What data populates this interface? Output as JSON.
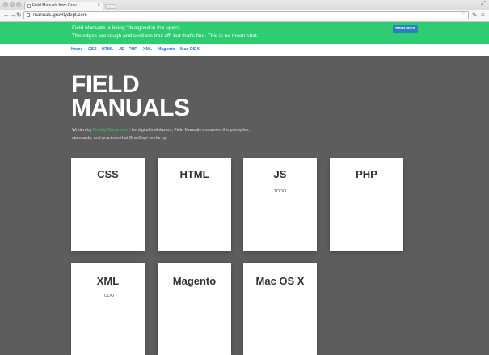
{
  "browser": {
    "tab_title": "Field Manuals from Grav",
    "url": "manuals.gravitydept.com"
  },
  "banner": {
    "line1": "Field Manuals is being “designed in the open”.",
    "line2": "The edges are rough and sections trail off, but that's fine. This is no moon shot.",
    "button_label": "Read More",
    "color": "#2fcc71"
  },
  "nav": {
    "items": [
      "Home",
      "CSS",
      "HTML",
      "JS",
      "PHP",
      "XML",
      "Magento",
      "Mac OS X"
    ]
  },
  "hero": {
    "title_line1": "FIELD",
    "title_line2": "MANUALS",
    "desc_before": "Written by ",
    "desc_link": "Gravity Department",
    "desc_after": " for digital trailblazers, Field Manuals document the principles, standards, and practices that GravDept works by."
  },
  "cards": [
    {
      "title": "CSS",
      "note": ""
    },
    {
      "title": "HTML",
      "note": ""
    },
    {
      "title": "JS",
      "note": "TODO"
    },
    {
      "title": "PHP",
      "note": ""
    },
    {
      "title": "XML",
      "note": "TODO"
    },
    {
      "title": "Magento",
      "note": ""
    },
    {
      "title": "Mac OS X",
      "note": ""
    }
  ]
}
